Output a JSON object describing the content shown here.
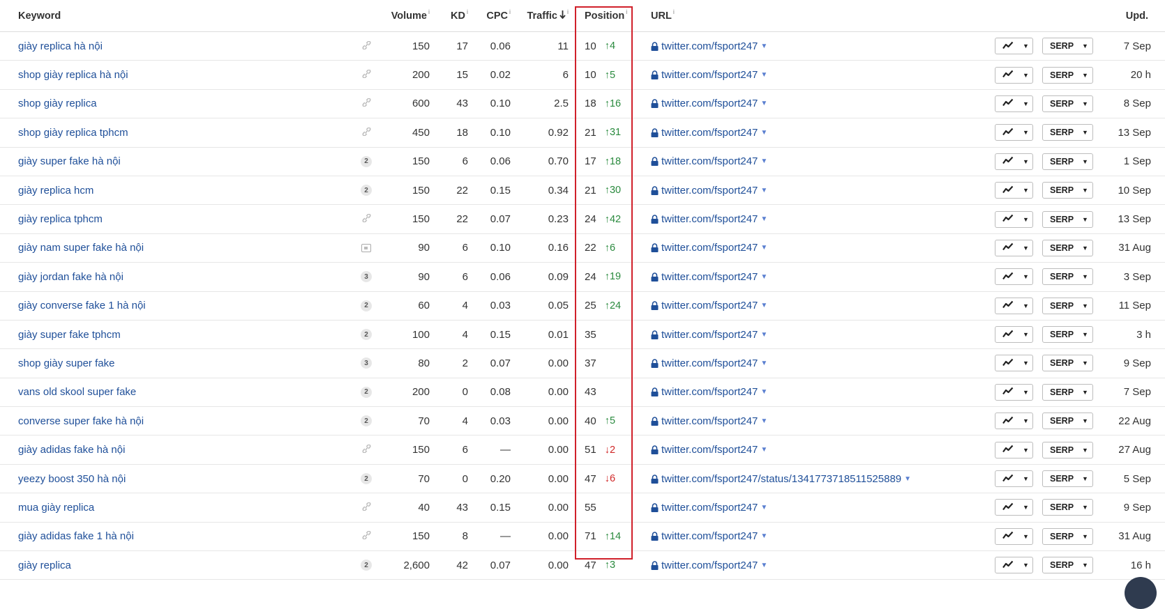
{
  "columns": {
    "keyword": "Keyword",
    "volume": "Volume",
    "kd": "KD",
    "cpc": "CPC",
    "traffic": "Traffic",
    "traffic_sort_icon": "arrow-down-icon",
    "position": "Position",
    "url": "URL",
    "updated": "Upd.",
    "info_glyph": "i"
  },
  "buttons": {
    "serp_label": "SERP",
    "chart_icon": "trend-chart-icon"
  },
  "colors": {
    "link": "#1f4f99",
    "up": "#2a8a3e",
    "down": "#d02828",
    "highlight": "#d0202a"
  },
  "rows": [
    {
      "keyword": "giày replica hà nội",
      "icon": "link",
      "badge": "",
      "volume": "150",
      "kd": "17",
      "cpc": "0.06",
      "traffic": "11",
      "position": "10",
      "change_dir": "up",
      "change": "4",
      "url": "twitter.com/fsport247",
      "updated": "7 Sep"
    },
    {
      "keyword": "shop giày replica hà nội",
      "icon": "link",
      "badge": "",
      "volume": "200",
      "kd": "15",
      "cpc": "0.02",
      "traffic": "6",
      "position": "10",
      "change_dir": "up",
      "change": "5",
      "url": "twitter.com/fsport247",
      "updated": "20 h"
    },
    {
      "keyword": "shop giày replica",
      "icon": "link",
      "badge": "",
      "volume": "600",
      "kd": "43",
      "cpc": "0.10",
      "traffic": "2.5",
      "position": "18",
      "change_dir": "up",
      "change": "16",
      "url": "twitter.com/fsport247",
      "updated": "8 Sep"
    },
    {
      "keyword": "shop giày replica tphcm",
      "icon": "link",
      "badge": "",
      "volume": "450",
      "kd": "18",
      "cpc": "0.10",
      "traffic": "0.92",
      "position": "21",
      "change_dir": "up",
      "change": "31",
      "url": "twitter.com/fsport247",
      "updated": "13 Sep"
    },
    {
      "keyword": "giày super fake hà nội",
      "icon": "badge",
      "badge": "2",
      "volume": "150",
      "kd": "6",
      "cpc": "0.06",
      "traffic": "0.70",
      "position": "17",
      "change_dir": "up",
      "change": "18",
      "url": "twitter.com/fsport247",
      "updated": "1 Sep"
    },
    {
      "keyword": "giày replica hcm",
      "icon": "badge",
      "badge": "2",
      "volume": "150",
      "kd": "22",
      "cpc": "0.15",
      "traffic": "0.34",
      "position": "21",
      "change_dir": "up",
      "change": "30",
      "url": "twitter.com/fsport247",
      "updated": "10 Sep"
    },
    {
      "keyword": "giày replica tphcm",
      "icon": "link",
      "badge": "",
      "volume": "150",
      "kd": "22",
      "cpc": "0.07",
      "traffic": "0.23",
      "position": "24",
      "change_dir": "up",
      "change": "42",
      "url": "twitter.com/fsport247",
      "updated": "13 Sep"
    },
    {
      "keyword": "giày nam super fake hà nội",
      "icon": "image",
      "badge": "",
      "volume": "90",
      "kd": "6",
      "cpc": "0.10",
      "traffic": "0.16",
      "position": "22",
      "change_dir": "up",
      "change": "6",
      "url": "twitter.com/fsport247",
      "updated": "31 Aug"
    },
    {
      "keyword": "giày jordan fake hà nội",
      "icon": "badge",
      "badge": "3",
      "volume": "90",
      "kd": "6",
      "cpc": "0.06",
      "traffic": "0.09",
      "position": "24",
      "change_dir": "up",
      "change": "19",
      "url": "twitter.com/fsport247",
      "updated": "3 Sep"
    },
    {
      "keyword": "giày converse fake 1 hà nội",
      "icon": "badge",
      "badge": "2",
      "volume": "60",
      "kd": "4",
      "cpc": "0.03",
      "traffic": "0.05",
      "position": "25",
      "change_dir": "up",
      "change": "24",
      "url": "twitter.com/fsport247",
      "updated": "11 Sep"
    },
    {
      "keyword": "giày super fake tphcm",
      "icon": "badge",
      "badge": "2",
      "volume": "100",
      "kd": "4",
      "cpc": "0.15",
      "traffic": "0.01",
      "position": "35",
      "change_dir": "",
      "change": "",
      "url": "twitter.com/fsport247",
      "updated": "3 h"
    },
    {
      "keyword": "shop giày super fake",
      "icon": "badge",
      "badge": "3",
      "volume": "80",
      "kd": "2",
      "cpc": "0.07",
      "traffic": "0.00",
      "position": "37",
      "change_dir": "",
      "change": "",
      "url": "twitter.com/fsport247",
      "updated": "9 Sep"
    },
    {
      "keyword": "vans old skool super fake",
      "icon": "badge",
      "badge": "2",
      "volume": "200",
      "kd": "0",
      "cpc": "0.08",
      "traffic": "0.00",
      "position": "43",
      "change_dir": "",
      "change": "",
      "url": "twitter.com/fsport247",
      "updated": "7 Sep"
    },
    {
      "keyword": "converse super fake hà nội",
      "icon": "badge",
      "badge": "2",
      "volume": "70",
      "kd": "4",
      "cpc": "0.03",
      "traffic": "0.00",
      "position": "40",
      "change_dir": "up",
      "change": "5",
      "url": "twitter.com/fsport247",
      "updated": "22 Aug"
    },
    {
      "keyword": "giày adidas fake hà nội",
      "icon": "link",
      "badge": "",
      "volume": "150",
      "kd": "6",
      "cpc": "—",
      "traffic": "0.00",
      "position": "51",
      "change_dir": "down",
      "change": "2",
      "url": "twitter.com/fsport247",
      "updated": "27 Aug"
    },
    {
      "keyword": "yeezy boost 350 hà nội",
      "icon": "badge",
      "badge": "2",
      "volume": "70",
      "kd": "0",
      "cpc": "0.20",
      "traffic": "0.00",
      "position": "47",
      "change_dir": "down",
      "change": "6",
      "url": "twitter.com/fsport247/status/1341773718511525889",
      "updated": "5 Sep"
    },
    {
      "keyword": "mua giày replica",
      "icon": "link",
      "badge": "",
      "volume": "40",
      "kd": "43",
      "cpc": "0.15",
      "traffic": "0.00",
      "position": "55",
      "change_dir": "",
      "change": "",
      "url": "twitter.com/fsport247",
      "updated": "9 Sep"
    },
    {
      "keyword": "giày adidas fake 1 hà nội",
      "icon": "link",
      "badge": "",
      "volume": "150",
      "kd": "8",
      "cpc": "—",
      "traffic": "0.00",
      "position": "71",
      "change_dir": "up",
      "change": "14",
      "url": "twitter.com/fsport247",
      "updated": "31 Aug"
    },
    {
      "keyword": "giày replica",
      "icon": "badge",
      "badge": "2",
      "volume": "2,600",
      "kd": "42",
      "cpc": "0.07",
      "traffic": "0.00",
      "position": "47",
      "change_dir": "up",
      "change": "3",
      "url": "twitter.com/fsport247",
      "updated": "16 h"
    }
  ]
}
